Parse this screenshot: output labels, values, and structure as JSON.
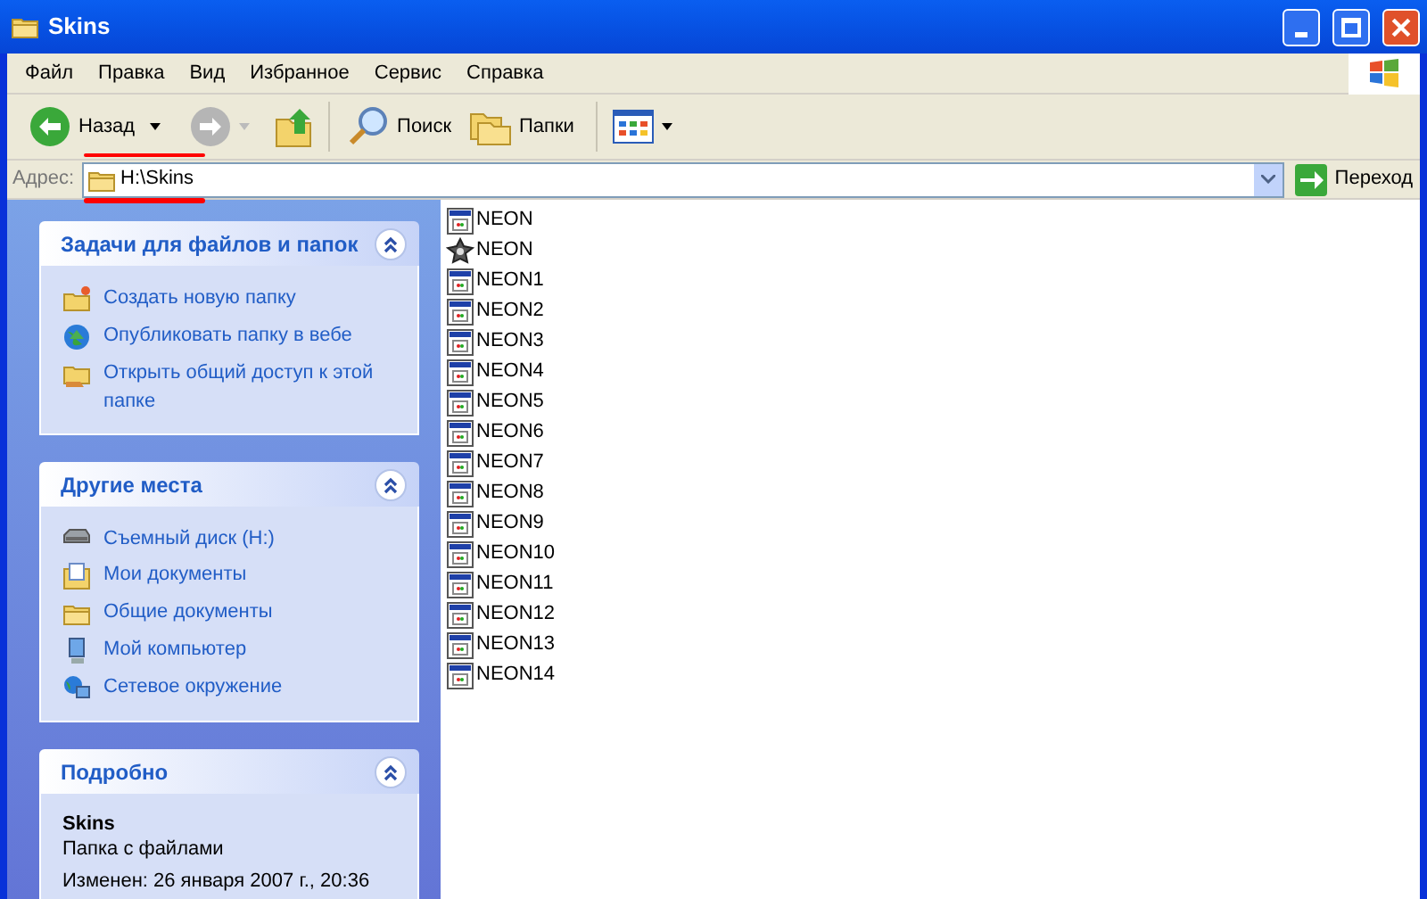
{
  "window": {
    "title": "Skins"
  },
  "menu": [
    "Файл",
    "Правка",
    "Вид",
    "Избранное",
    "Сервис",
    "Справка"
  ],
  "toolbar": {
    "back": "Назад",
    "search": "Поиск",
    "folders": "Папки"
  },
  "address": {
    "label": "Адрес:",
    "value": "H:\\Skins",
    "go": "Переход"
  },
  "panels": [
    {
      "title": "Задачи для файлов и папок",
      "kind": "links",
      "items": [
        {
          "label": "Создать новую папку"
        },
        {
          "label": "Опубликовать папку в вебе"
        },
        {
          "label": "Открыть общий доступ к этой папке"
        }
      ]
    },
    {
      "title": "Другие места",
      "kind": "links",
      "items": [
        {
          "label": "Съемный диск (H:)"
        },
        {
          "label": "Мои документы"
        },
        {
          "label": "Общие документы"
        },
        {
          "label": "Мой компьютер"
        },
        {
          "label": "Сетевое окружение"
        }
      ]
    },
    {
      "title": "Подробно",
      "kind": "details",
      "name": "Skins",
      "type": "Папка с файлами",
      "modified": "Изменен: 26 января 2007 г., 20:36"
    }
  ],
  "files": [
    {
      "name": "NEON",
      "kind": "app"
    },
    {
      "name": "NEON",
      "kind": "star"
    },
    {
      "name": "NEON1",
      "kind": "app"
    },
    {
      "name": "NEON2",
      "kind": "app"
    },
    {
      "name": "NEON3",
      "kind": "app"
    },
    {
      "name": "NEON4",
      "kind": "app"
    },
    {
      "name": "NEON5",
      "kind": "app"
    },
    {
      "name": "NEON6",
      "kind": "app"
    },
    {
      "name": "NEON7",
      "kind": "app"
    },
    {
      "name": "NEON8",
      "kind": "app"
    },
    {
      "name": "NEON9",
      "kind": "app"
    },
    {
      "name": "NEON10",
      "kind": "app"
    },
    {
      "name": "NEON11",
      "kind": "app"
    },
    {
      "name": "NEON12",
      "kind": "app"
    },
    {
      "name": "NEON13",
      "kind": "app"
    },
    {
      "name": "NEON14",
      "kind": "app"
    }
  ]
}
